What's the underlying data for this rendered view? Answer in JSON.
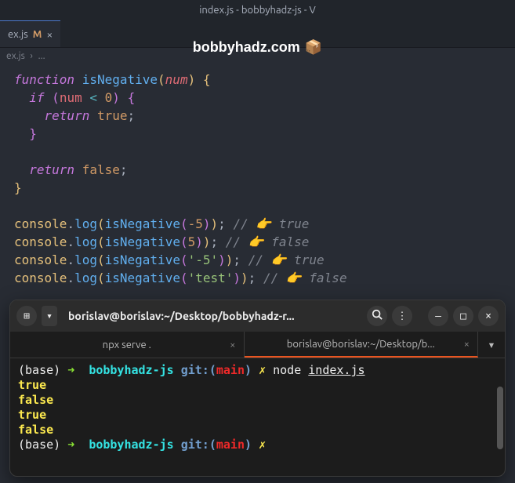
{
  "window": {
    "title": "index.js - bobbyhadz-js - V"
  },
  "tab": {
    "filename": "ex.js",
    "modified_marker": "M",
    "close_glyph": "×"
  },
  "watermark": {
    "text": "bobbyhadz.com",
    "icon": "📦"
  },
  "breadcrumb": {
    "file": "ex.js",
    "sep": "›",
    "rest": "..."
  },
  "code": {
    "l1_function": "function",
    "l1_fname": "isNegative",
    "l1_param": "num",
    "l2_if": "if",
    "l2_var": "num",
    "l2_op": "<",
    "l2_zero": "0",
    "l3_return": "return",
    "l3_true": "true",
    "l5_return": "return",
    "l5_false": "false",
    "c_console": "console",
    "c_log": "log",
    "c_fn": "isNegative",
    "c1_arg": "-5",
    "c1_comment": "// 👉️ true",
    "c2_arg": "5",
    "c2_comment": "// 👉️ false",
    "c3_arg": "'-5'",
    "c3_comment": "// 👉️ true",
    "c4_arg": "'test'",
    "c4_comment": "// 👉️ false"
  },
  "terminal": {
    "header_title": "borislav@borislav:~/Desktop/bobbyhadz-r...",
    "icons": {
      "new_tab": "⊞",
      "dropdown": "▾",
      "search": "🔍",
      "menu": "⋮",
      "minimize": "—",
      "maximize": "□",
      "close": "×"
    },
    "tabs": [
      {
        "label": "npx serve .",
        "active": false
      },
      {
        "label": "borislav@borislav:~/Desktop/b...",
        "active": true
      }
    ],
    "prompt": {
      "base": "(base)",
      "arrow": "➜",
      "dir": "bobbyhadz-js",
      "git_label": "git:(",
      "branch": "main",
      "git_close": ")",
      "dirty": "✗"
    },
    "cmd1": {
      "bin": "node",
      "arg": "index.js"
    },
    "output": [
      "true",
      "false",
      "true",
      "false"
    ]
  }
}
